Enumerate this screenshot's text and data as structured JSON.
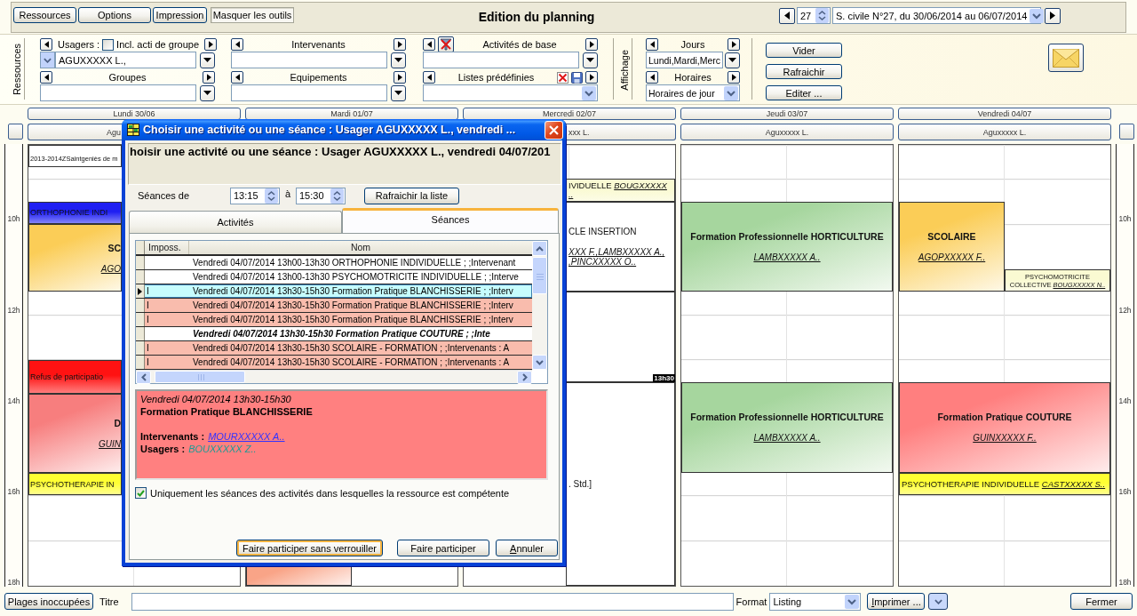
{
  "toolbar": {
    "buttons": [
      {
        "label": "Ressources",
        "pressed": false
      },
      {
        "label": "Options",
        "pressed": false
      },
      {
        "label": "Impression",
        "pressed": false
      },
      {
        "label": "Masquer les outils",
        "pressed": true
      }
    ],
    "title": "Edition du planning",
    "week": "27",
    "period": "S. civile N°27, du 30/06/2014 au 06/07/2014"
  },
  "tools": {
    "resources_label": "Ressources",
    "filters": [
      {
        "kind": "users",
        "label": "Usagers :",
        "option": {
          "label": "Incl. acti de groupe",
          "checked": false
        },
        "value": "AGUXXXXX L.,"
      },
      {
        "kind": "plain",
        "label": "Intervenants"
      },
      {
        "kind": "base",
        "label": "Activités de base"
      },
      {
        "kind": "plain",
        "label": "Groupes"
      },
      {
        "kind": "plain",
        "label": "Equipements"
      },
      {
        "kind": "preset",
        "label": "Listes prédéfinies"
      }
    ],
    "display_label": "Affichage",
    "display": [
      {
        "kind": "plain",
        "label": "Jours",
        "value": "Lundi,Mardi,Merc"
      },
      {
        "kind": "select",
        "label": "Horaires",
        "value": "Horaires de jour"
      }
    ],
    "actions": [
      "Vider",
      "Rafraichir",
      "Editer ..."
    ]
  },
  "calendar": {
    "left_axis": [
      "10h",
      "12h",
      "14h",
      "16h",
      "18h"
    ],
    "days": [
      {
        "header": "Lundi 30/06",
        "resource": "Agu",
        "events": [
          {
            "kind": "note",
            "color": "#ffffff",
            "title": "2013-2014ZSaintgeniès de m"
          },
          {
            "kind": "strip",
            "color": "#1f1ff2",
            "title": "ORTHOPHONIE INDI"
          },
          {
            "kind": "block",
            "color": "#fbcd57",
            "title": "SC",
            "people": [
              "AGO"
            ]
          },
          {
            "kind": "strip",
            "color": "#ff1212",
            "title": "Refus de participatio"
          },
          {
            "kind": "block",
            "color": "#f77e7e",
            "title": "D",
            "people": [
              "GUIN"
            ]
          },
          {
            "kind": "strip",
            "color": "#ffff33",
            "title": "PSYCHOTHERAPIE IN"
          }
        ]
      },
      {
        "header": "Mardi 01/07",
        "events": [
          {
            "kind": "block",
            "color": "#f9a487"
          }
        ]
      },
      {
        "header": "Mercredi 02/07",
        "resource": "xxx L.",
        "events": [
          {
            "kind": "strip",
            "color": "#fafad2",
            "title": "IVIDUELLE",
            "people": [
              "BOUGXXXXX",
              ".."
            ]
          },
          {
            "kind": "group",
            "color": "#ffffff",
            "title": "CLE INSERTION",
            "people": [
              "XXX F.,LAMBXXXXX A.,",
              ",PINCXXXXX O.."
            ]
          },
          {
            "kind": "group",
            "color": "#ffffff",
            "end_label": "13h30"
          },
          {
            "kind": "group",
            "color": "#ffffff",
            "title": ". Std.]"
          }
        ]
      },
      {
        "header": "Jeudi 03/07",
        "resource": "Aguxxxxx L.",
        "events": [
          {
            "kind": "block",
            "color": "#a6d69e",
            "title": "Formation Professionnelle HORTICULTURE",
            "people": [
              "LAMBXXXXX A.."
            ]
          },
          {
            "kind": "block",
            "color": "#a6d69e",
            "title": "Formation Professionnelle HORTICULTURE",
            "people": [
              "LAMBXXXXX A.."
            ]
          }
        ]
      },
      {
        "header": "Vendredi 04/07",
        "resource": "Aguxxxxx L.",
        "events": [
          {
            "kind": "block",
            "color": "#fbcd57",
            "title": "SCOLAIRE",
            "people": [
              "AGOPXXXXX F.."
            ]
          },
          {
            "kind": "strip",
            "color": "#fafad2",
            "title": "PSYCHOMOTRICITE COLLECTIVE",
            "people": [
              "BOUGXXXXX N.."
            ]
          },
          {
            "kind": "block",
            "color": "#ff7f7f",
            "title": "Formation Pratique COUTURE",
            "people": [
              "GUINXXXXX F.."
            ]
          },
          {
            "kind": "strip",
            "color": "#ffff33",
            "title": "PSYCHOTHERAPIE INDIVIDUELLE",
            "people": [
              "CASTXXXXX S.."
            ]
          }
        ]
      }
    ],
    "right_axis": [
      "10h",
      "12h",
      "14h",
      "16h",
      "18h"
    ]
  },
  "dialog": {
    "title": "Choisir une activité ou une séance : Usager AGUXXXXX L., vendredi ...",
    "heading": "hoisir une activité ou une séance : Usager AGUXXXXX L., vendredi 04/07/201",
    "range_label": "Séances de",
    "from": "13:15",
    "to_label": "à",
    "to": "15:30",
    "refresh": "Rafraichir la liste",
    "tabs": [
      {
        "label": "Activités",
        "selected": false
      },
      {
        "label": "Séances",
        "selected": true
      }
    ],
    "table": {
      "columns": [
        "Imposs.",
        "Nom"
      ],
      "rows": [
        {
          "name": "Vendredi 04/07/2014 13h00-13h30 ORTHOPHONIE INDIVIDUELLE ; ;Intervenant",
          "selected": false,
          "current": false
        },
        {
          "name": "Vendredi 04/07/2014 13h00-13h30 PSYCHOMOTRICITE INDIVIDUELLE ; ;Interve",
          "selected": false,
          "current": false
        },
        {
          "imposs": "I",
          "name": "Vendredi 04/07/2014 13h30-15h30 Formation Pratique BLANCHISSERIE ; ;Interv",
          "selected": true,
          "current": false
        },
        {
          "imposs": "I",
          "name": "Vendredi 04/07/2014 13h30-15h30 Formation Pratique BLANCHISSERIE ; ;Interv",
          "selected": false,
          "current": false
        },
        {
          "imposs": "I",
          "name": "Vendredi 04/07/2014 13h30-15h30 Formation Pratique BLANCHISSERIE ; ;Interv",
          "selected": false,
          "current": false
        },
        {
          "name": "Vendredi 04/07/2014 13h30-15h30 Formation Pratique COUTURE ; ;Inte",
          "selected": false,
          "current": true
        },
        {
          "imposs": "I",
          "name": "Vendredi 04/07/2014 13h30-15h30 SCOLAIRE - FORMATION ; ;Intervenants : A",
          "selected": false,
          "current": false
        },
        {
          "imposs": "I",
          "name": "Vendredi 04/07/2014 13h30-15h30 SCOLAIRE - FORMATION ; ;Intervenants : A",
          "selected": false,
          "current": false
        }
      ]
    },
    "details": {
      "when": "Vendredi 04/07/2014 13h30-15h30",
      "activity": "Formation Pratique BLANCHISSERIE",
      "staff_label": "Intervenants :",
      "staff": "MOURXXXXX A..",
      "users_label": "Usagers :",
      "users": "BOUXXXXX Z.."
    },
    "competent_only": {
      "label": "Uniquement les séances des activités dans lesquelles la ressource est compétente",
      "checked": true
    },
    "buttons": [
      {
        "label": "Faire participer sans verrouiller",
        "focused": true
      },
      {
        "label": "Faire participer",
        "focused": false
      },
      {
        "label": "Annuler",
        "focused": false
      }
    ]
  },
  "footer": {
    "unoccupied": "Plages inoccupées",
    "title_label": "Titre",
    "format_label": "Format",
    "format": "Listing",
    "print": "Imprimer ...",
    "close": "Fermer"
  }
}
